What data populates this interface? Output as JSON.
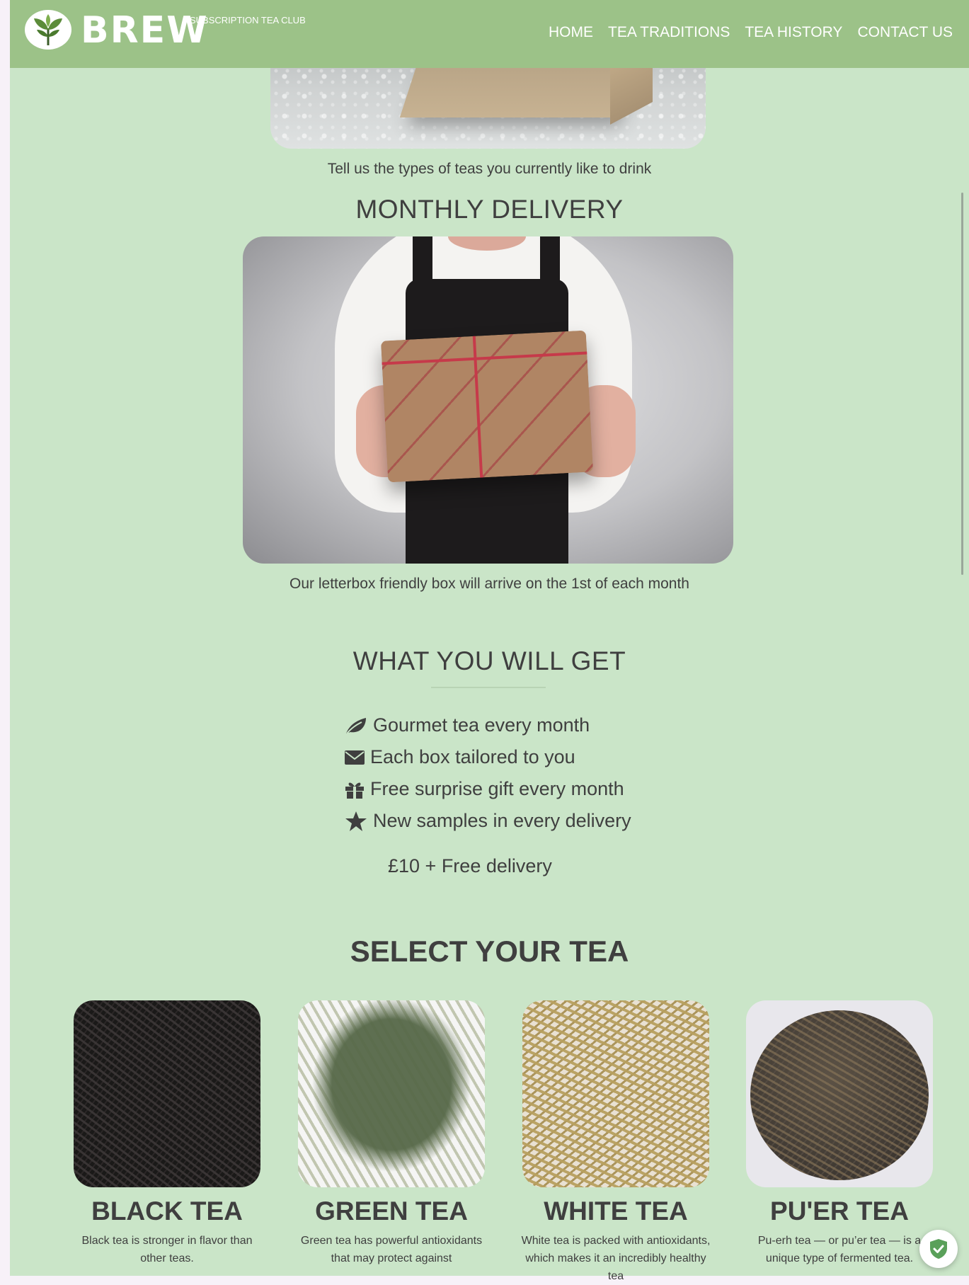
{
  "header": {
    "brand": "BREW",
    "tagline": "SUBSCRIPTION TEA CLUB",
    "nav": [
      "HOME",
      "TEA TRADITIONS",
      "TEA HISTORY",
      "CONTACT US"
    ]
  },
  "intro": {
    "caption": "Tell us the types of teas you currently like to drink"
  },
  "monthly": {
    "heading": "MONTHLY DELIVERY",
    "caption": "Our letterbox friendly box will arrive on the 1st of each month"
  },
  "benefits": {
    "heading": "WHAT YOU WILL GET",
    "items": [
      {
        "icon": "leaf-icon",
        "text": "Gourmet tea every month"
      },
      {
        "icon": "envelope-icon",
        "text": "Each box tailored to you"
      },
      {
        "icon": "gift-icon",
        "text": "Free surprise gift every month"
      },
      {
        "icon": "star-icon",
        "text": "New samples in every delivery"
      }
    ],
    "price": "£10 + Free delivery"
  },
  "select": {
    "heading": "SELECT YOUR TEA",
    "teas": [
      {
        "name": "BLACK TEA",
        "desc": "Black tea is stronger in flavor than other teas."
      },
      {
        "name": "GREEN TEA",
        "desc": "Green tea has powerful antioxidants that may protect against"
      },
      {
        "name": "WHITE TEA",
        "desc": "White tea is packed with antioxidants, which makes it an incredibly healthy tea"
      },
      {
        "name": "PU'ER TEA",
        "desc": "Pu-erh tea — or pu’er tea — is a unique type of fermented tea."
      }
    ]
  },
  "colors": {
    "navbar": "#9cc288",
    "background": "#cae5c8",
    "text": "#3f3f3f",
    "nav_text": "#ffffff"
  }
}
